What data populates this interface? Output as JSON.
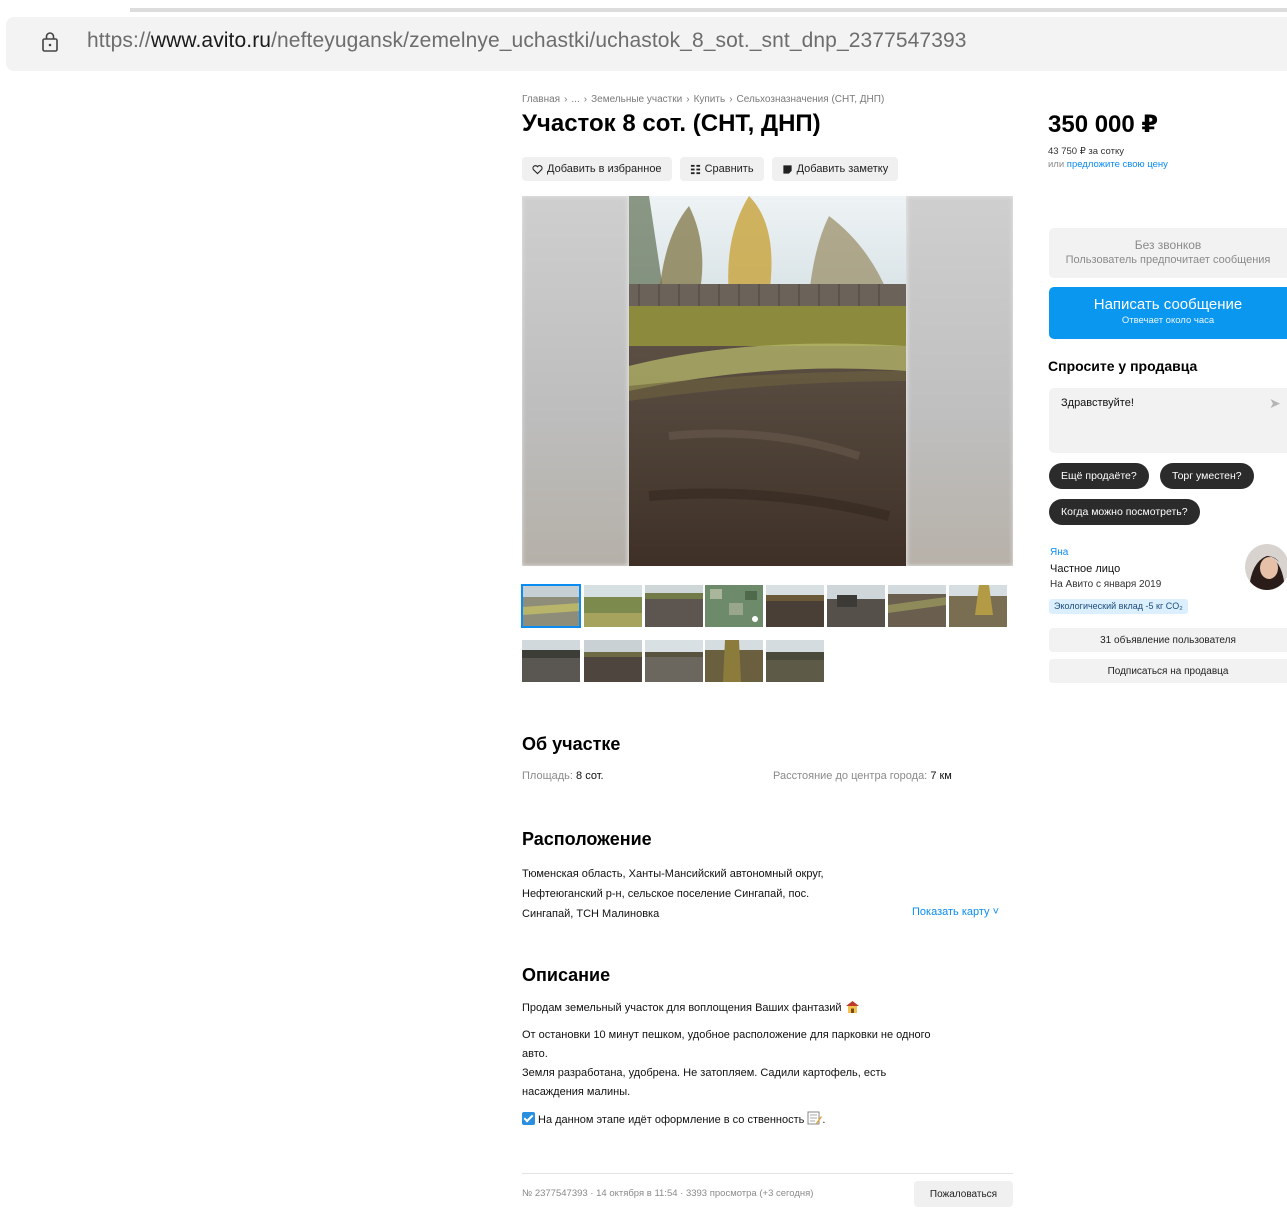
{
  "browser": {
    "url_prefix": "https://",
    "url_domain": "www.avito.ru",
    "url_path": "/nefteyugansk/zemelnye_uchastki/uchastok_8_sot._snt_dnp_2377547393"
  },
  "breadcrumbs": [
    "Главная",
    "...",
    "Земельные участки",
    "Купить",
    "Сельхозназначения (СНТ, ДНП)"
  ],
  "breadcrumb_separator": "›",
  "title": "Участок 8 сот. (СНТ, ДНП)",
  "actions": {
    "favorite": "Добавить в избранное",
    "compare": "Сравнить",
    "note": "Добавить заметку"
  },
  "gallery": {
    "thumbnail_count_row1": 8,
    "thumbnail_count_row2": 5
  },
  "about": {
    "heading": "Об участке",
    "area_label": "Площадь:",
    "area_value": "8 сот.",
    "distance_label": "Расстояние до центра города:",
    "distance_value": "7 км"
  },
  "location": {
    "heading": "Расположение",
    "line1": "Тюменская область, Ханты-Мансийский автономный округ,",
    "line2": "Нефтеюганский р-н, сельское поселение Сингапай, пос.",
    "line3": "Сингапай, ТСН Малиновка",
    "show_map": "Показать карту ˅"
  },
  "description": {
    "heading": "Описание",
    "p1": "Продам земельный участок для воплощения Ваших фантазий",
    "p2_line1": "От остановки 10 минут пешком, удобное расположение для парковки не одного",
    "p2_line2": "авто.",
    "p3_line1": "Земля разработана, удобрена. Не затопляем. Садили картофель, есть",
    "p3_line2": "насаждения малины.",
    "p4": "На данном этапе идёт оформление в со ственность",
    "p4_end": "."
  },
  "footer": {
    "meta": "№ 2377547393 · 14 октября в 11:54 · 3393 просмотра (+3 сегодня)",
    "report": "Пожаловаться"
  },
  "sidebar": {
    "price": "350 000 ₽",
    "price_per_unit": "43 750 ₽ за сотку",
    "offer_prefix": "или ",
    "offer_link": "предложите свою цену",
    "no_calls_title": "Без звонков",
    "no_calls_sub": "Пользователь предпочитает сообщения",
    "write_btn": "Написать сообщение",
    "write_btn_sub": "Отвечает около часа",
    "ask_heading": "Спросите у продавца",
    "ask_input_value": "Здравствуйте!",
    "chips": [
      "Ещё продаёте?",
      "Торг уместен?",
      "Когда можно посмотреть?"
    ],
    "seller_name": "Яна",
    "seller_type": "Частное лицо",
    "seller_since": "На Авито с января 2019",
    "eco": "Экологический вклад -5 кг CO₂",
    "listings_btn": "31 объявление пользователя",
    "subscribe_btn": "Подписаться на продавца"
  },
  "colors": {
    "accent": "#0a97f0",
    "link": "#0a8cf0",
    "chip_bg": "#2b2b2b",
    "panel_bg": "#f2f2f2"
  }
}
